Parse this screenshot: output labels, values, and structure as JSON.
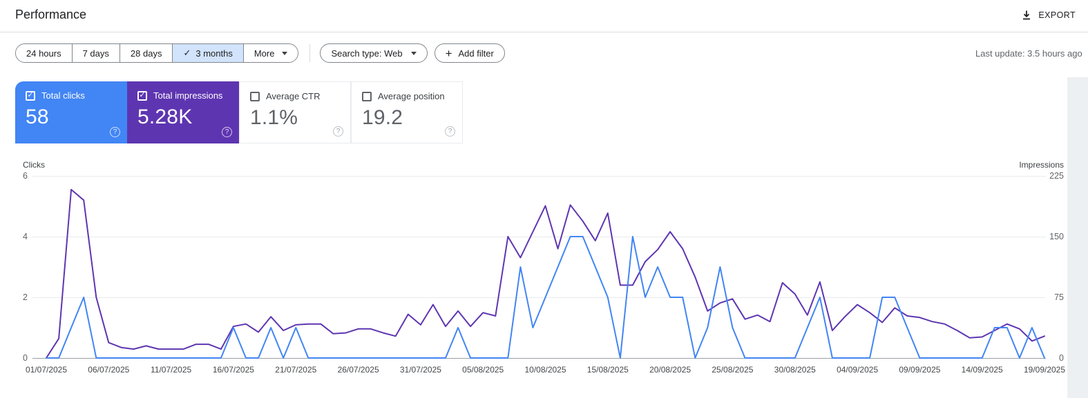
{
  "header": {
    "title": "Performance",
    "export_label": "EXPORT"
  },
  "toolbar": {
    "date_filters": [
      {
        "label": "24 hours",
        "selected": false
      },
      {
        "label": "7 days",
        "selected": false
      },
      {
        "label": "28 days",
        "selected": false
      },
      {
        "label": "3 months",
        "selected": true
      },
      {
        "label": "More",
        "selected": false
      }
    ],
    "selected_check": "✓",
    "search_type_label": "Search type: Web",
    "add_filter_label": "Add filter",
    "last_update": "Last update: 3.5 hours ago"
  },
  "metrics": [
    {
      "label": "Total clicks",
      "value": "58",
      "checked": true,
      "color": "#4285f4"
    },
    {
      "label": "Total impressions",
      "value": "5.28K",
      "checked": true,
      "color": "#5e35b1"
    },
    {
      "label": "Average CTR",
      "value": "1.1%",
      "checked": false,
      "color": "#ffffff"
    },
    {
      "label": "Average position",
      "value": "19.2",
      "checked": false,
      "color": "#ffffff"
    }
  ],
  "help_glyph": "?",
  "chart_data": {
    "type": "line",
    "x_tick_labels": [
      "01/07/2025",
      "06/07/2025",
      "11/07/2025",
      "16/07/2025",
      "21/07/2025",
      "26/07/2025",
      "31/07/2025",
      "05/08/2025",
      "10/08/2025",
      "15/08/2025",
      "20/08/2025",
      "25/08/2025",
      "30/08/2025",
      "04/09/2025",
      "09/09/2025",
      "14/09/2025",
      "19/09/2025"
    ],
    "x_days_per_tick": 5,
    "left_axis": {
      "title": "Clicks",
      "ticks": [
        6,
        4,
        2,
        0
      ],
      "max": 6
    },
    "right_axis": {
      "title": "Impressions",
      "ticks": [
        225,
        150,
        75,
        0
      ],
      "max": 225
    },
    "grid": true,
    "legend_position": "none",
    "series": [
      {
        "name": "Impressions",
        "axis": "right",
        "color": "#5e35b1",
        "values": [
          0,
          24,
          208,
          195,
          75,
          19,
          13,
          11,
          15,
          11,
          11,
          11,
          17,
          17,
          11,
          39,
          42,
          32,
          51,
          34,
          41,
          42,
          42,
          30,
          31,
          36,
          36,
          31,
          27,
          54,
          41,
          66,
          39,
          58,
          39,
          56,
          52,
          150,
          124,
          156,
          188,
          135,
          189,
          169,
          145,
          179,
          90,
          90,
          119,
          134,
          156,
          135,
          100,
          58,
          68,
          73,
          48,
          53,
          45,
          93,
          79,
          53,
          94,
          34,
          51,
          66,
          56,
          44,
          62,
          52,
          50,
          45,
          42,
          34,
          25,
          26,
          34,
          42,
          36,
          21,
          27
        ]
      },
      {
        "name": "Clicks",
        "axis": "left",
        "color": "#4285f4",
        "values": [
          0,
          0,
          1,
          2,
          0,
          0,
          0,
          0,
          0,
          0,
          0,
          0,
          0,
          0,
          0,
          1,
          0,
          0,
          1,
          0,
          1,
          0,
          0,
          0,
          0,
          0,
          0,
          0,
          0,
          0,
          0,
          0,
          0,
          1,
          0,
          0,
          0,
          0,
          3,
          1,
          2,
          3,
          4,
          4,
          3,
          2,
          0,
          4,
          2,
          3,
          2,
          2,
          0,
          1,
          3,
          1,
          0,
          0,
          0,
          0,
          0,
          1,
          2,
          0,
          0,
          0,
          0,
          2,
          2,
          1,
          0,
          0,
          0,
          0,
          0,
          0,
          1,
          1,
          0,
          1,
          0
        ]
      }
    ]
  }
}
